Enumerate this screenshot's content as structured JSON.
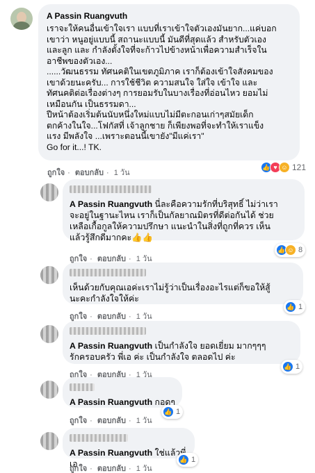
{
  "post": {
    "author": "A Passin Ruangvuth",
    "text": "เราจะให้คนอื่นเข้าใจเรา แบบที่เราเข้าใจตัวเองมันยาก...แค่บอก\nเขาว่า หนูอยู่แบบนี้ สถานะแบบนี้ มันดีที่สุดแล้ว สำหรับตัวเอง\nและลูก และ กำลังตั้งใจที่จะก้าวไปข้างหน้าเพื่อความสำเร็จใน\nอาชีพของตัวเอง...\n......วัฒนธรรม ทัศนคติในเขตภูมิภาค เราก็ต้องเข้าใจสังคมของ\nเขาด้วยนะครับ... การใช้ชีวิต ความสนใจ ใส่ใจ เข้าใจ และ\nทัศนคติต่อเรื่องต่างๆ การยอมรับในบางเรื่องที่อ่อนไหว ยอมไม่\nเหมือนกัน เป็นธรรมดา...\nปีหน้าต้องเริ่มต้นนับหนึ่งใหม่แบบไม่มีตะกอนเก่าๆสมัยเด็ก\nตกค้างในใจ...โฟกัสที่ เจ้าลูกชาย ก็เพียงพอที่จะทำให้เราแข็ง\nแรง มีพลังใจ ...เพราะตอนนี้เขายัง\"มีแค่เรา\"\nGo for it...! TK.",
    "like": "ถูกใจ",
    "reply": "ตอบกลับ",
    "time": "1 วัน",
    "reaction_count": "121"
  },
  "replies": [
    {
      "tag": "A Passin Ruangvuth",
      "text": " นี่ละคือความรักที่บริสุทธิ์ ไม่ว่าเรา\nจะอยู่ในฐานะไหน เราก็เป็นกัลยาณมิตรที่ดีต่อกันได้ ช่วย\nเหลือเกื้อกูลให้ความปรึกษา แนะนำในสิ่งที่ถูกที่ควร เห็น\nแล้วรู้สึกดีมากคะ👍👍",
      "like": "ถูกใจ",
      "reply": "ตอบกลับ",
      "time": "1 วัน",
      "reaction_count": "8"
    },
    {
      "tag": "",
      "text": "เห็นด้วยกับคุณเอค่ะเราไม่รู้ว่าเป็นเรื่องอะไรแต่ก็ขอให้สู้\nนะคะกำลังใจให้ค่ะ",
      "like": "ถูกใจ",
      "reply": "ตอบกลับ",
      "time": "1 วัน",
      "reaction_count": "1"
    },
    {
      "tag": "A Passin Ruangvuth",
      "text": " เป็นกำลังใจ ยอดเยี่ยม มากๆๆๆ\nรักครอบครัว พี่เอ ค่ะ เป็นกำลังใจ ตลอดไป ค่ะ",
      "like": "ถูกใจ",
      "reply": "ตอบกลับ",
      "time": "1 วัน",
      "reaction_count": "1"
    },
    {
      "tag": "A Passin Ruangvuth",
      "text": " กอดๆ",
      "like": "ถูกใจ",
      "reply": "ตอบกลับ",
      "time": "1 วัน",
      "reaction_count": "1"
    },
    {
      "tag": "A Passin Ruangvuth",
      "text": " ใช่แล้วพี่เอ",
      "like": "ถูกใจ",
      "reply": "ตอบกลับ",
      "time": "1 วัน",
      "reaction_count": "1"
    }
  ],
  "icons": {
    "like": "like-icon",
    "love": "love-icon",
    "care": "care-icon"
  },
  "colors": {
    "bubble": "#f0f2f5",
    "like_blue": "#1877f2",
    "meta": "#65676b"
  }
}
